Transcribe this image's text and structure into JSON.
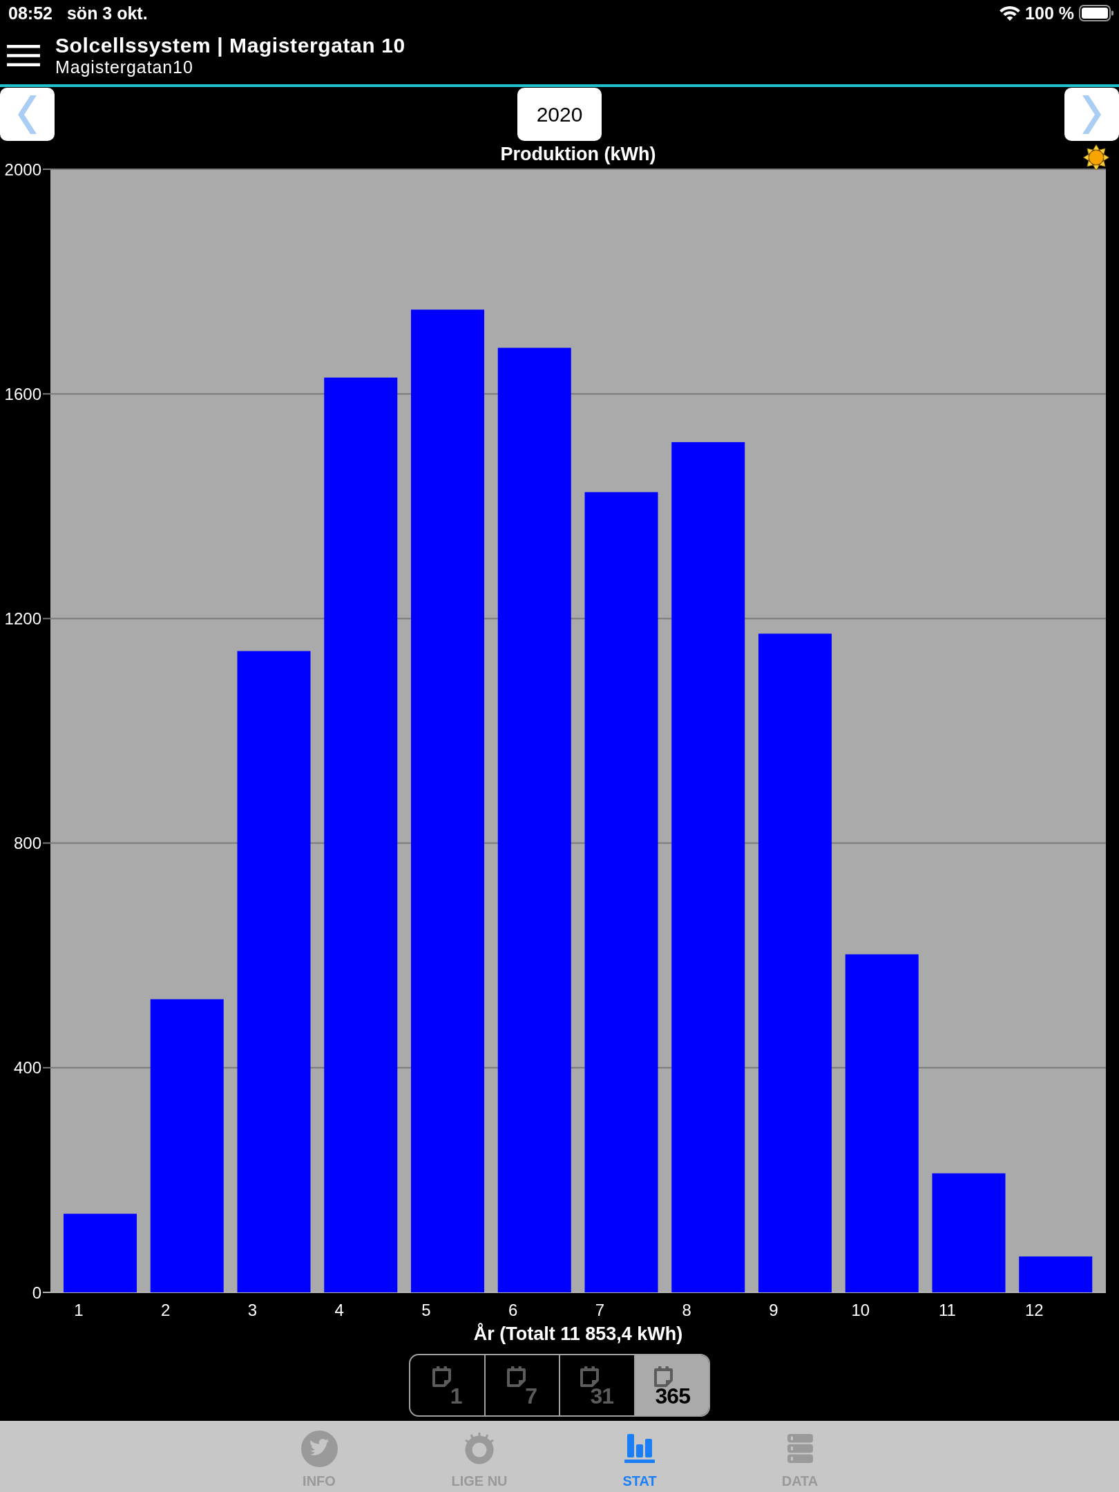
{
  "status_bar": {
    "time": "08:52",
    "date": "sön 3 okt.",
    "battery": "100 %"
  },
  "header": {
    "title": "Solcellssystem | Magistergatan 10",
    "subtitle": "Magistergatan10"
  },
  "period_nav": {
    "label": "2020"
  },
  "chart": {
    "chart_data": {
      "type": "bar",
      "title": "Produktion (kWh)",
      "xlabel": "År (Totalt 11 853,4 kWh)",
      "categories": [
        "1",
        "2",
        "3",
        "4",
        "5",
        "6",
        "7",
        "8",
        "9",
        "10",
        "11",
        "12"
      ],
      "values": [
        140,
        522,
        1142,
        1629,
        1750,
        1682,
        1425,
        1514,
        1173,
        602,
        212,
        64
      ],
      "ylim": [
        0,
        2000
      ],
      "yticks": [
        0,
        400,
        800,
        1200,
        1600,
        2000
      ],
      "grid": true
    }
  },
  "range_selector": [
    {
      "label": "1",
      "selected": false
    },
    {
      "label": "7",
      "selected": false
    },
    {
      "label": "31",
      "selected": false
    },
    {
      "label": "365",
      "selected": true
    }
  ],
  "tab_bar": [
    {
      "label": "INFO",
      "selected": false
    },
    {
      "label": "LIGE NU",
      "selected": false
    },
    {
      "label": "STAT",
      "selected": true
    },
    {
      "label": "DATA",
      "selected": false
    }
  ]
}
